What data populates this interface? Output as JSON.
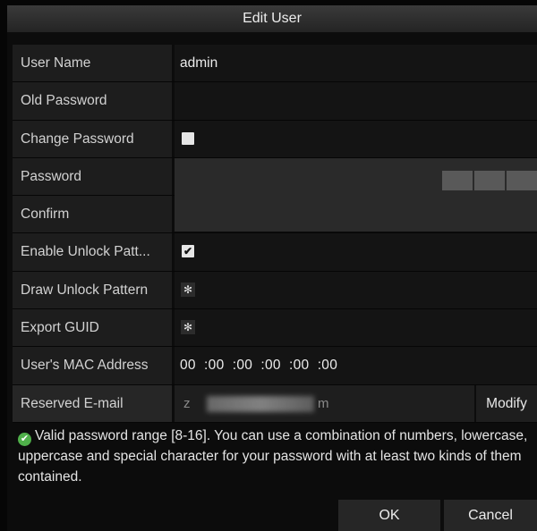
{
  "dialog": {
    "title": "Edit User"
  },
  "fields": {
    "user_name": {
      "label": "User Name",
      "value": "admin"
    },
    "old_password": {
      "label": "Old Password"
    },
    "change_password": {
      "label": "Change Password",
      "checked": false
    },
    "password": {
      "label": "Password"
    },
    "confirm": {
      "label": "Confirm"
    },
    "enable_unlock_pattern": {
      "label": "Enable Unlock Patt...",
      "checked": true
    },
    "draw_unlock_pattern": {
      "label": "Draw Unlock Pattern",
      "icon": "gear-icon"
    },
    "export_guid": {
      "label": "Export GUID",
      "icon": "gear-icon"
    },
    "mac_address": {
      "label": "User's MAC Address",
      "value": "00  :00  :00  :00  :00  :00"
    },
    "reserved_email": {
      "label": "Reserved E-mail",
      "value_prefix": "z",
      "value_suffix": "m",
      "modify_label": "Modify"
    }
  },
  "note": "Valid password range [8-16]. You can use a combination of numbers, lowercase, uppercase and special character for your password with at least two kinds of them contained.",
  "buttons": {
    "ok": "OK",
    "cancel": "Cancel"
  },
  "colors": {
    "valid_icon": "#4fb04a"
  }
}
